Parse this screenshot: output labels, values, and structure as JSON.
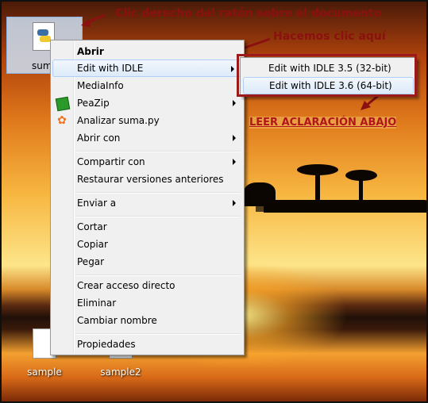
{
  "desktop": {
    "selected_file_label": "suma.py",
    "icons": [
      {
        "label": "sample"
      },
      {
        "label": "sample2"
      }
    ]
  },
  "annotations": {
    "right_click_note": "Clic derecho del ratón sobre el documento",
    "click_here_note": "Hacemos clic aquí",
    "read_note": "LEER ACLARACIÓN ABAJO",
    "asterisk": "*",
    "accent_color": "#8b1010"
  },
  "context_menu": {
    "items": [
      {
        "label": "Abrir",
        "bold": true
      },
      {
        "label": "Edit with IDLE",
        "submenu": true,
        "highlighted": true
      },
      {
        "label": "MediaInfo"
      },
      {
        "label": "PeaZip",
        "submenu": true,
        "icon": "peazip-icon"
      },
      {
        "label": "Analizar suma.py",
        "icon": "avast-icon"
      },
      {
        "label": "Abrir con",
        "submenu": true
      },
      {
        "label": "Compartir con",
        "submenu": true
      },
      {
        "label": "Restaurar versiones anteriores"
      },
      {
        "label": "Enviar a",
        "submenu": true
      },
      {
        "label": "Cortar"
      },
      {
        "label": "Copiar"
      },
      {
        "label": "Pegar"
      },
      {
        "label": "Crear acceso directo"
      },
      {
        "label": "Eliminar"
      },
      {
        "label": "Cambiar nombre"
      },
      {
        "label": "Propiedades"
      }
    ]
  },
  "submenu": {
    "items": [
      {
        "label": "Edit with IDLE 3.5 (32-bit)"
      },
      {
        "label": "Edit with IDLE 3.6 (64-bit)",
        "highlighted": true
      }
    ]
  }
}
